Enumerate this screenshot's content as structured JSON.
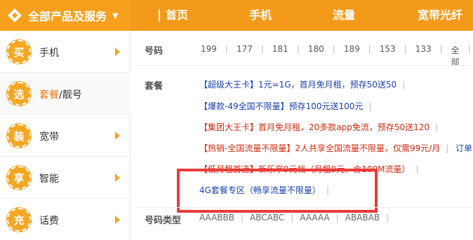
{
  "header": {
    "category_title": "全部产品及服务",
    "nav": [
      "首页",
      "手机",
      "流量",
      "宽带光纤"
    ]
  },
  "sidebar": {
    "items": [
      {
        "badge": "买",
        "label": "手机",
        "label_highlight": "",
        "label_rest": ""
      },
      {
        "badge": "选",
        "label": "",
        "label_highlight": "套餐",
        "label_rest": "/靓号"
      },
      {
        "badge": "装",
        "label": "宽带",
        "label_highlight": "",
        "label_rest": ""
      },
      {
        "badge": "享",
        "label": "智能",
        "label_highlight": "",
        "label_rest": ""
      },
      {
        "badge": "充",
        "label": "话费",
        "label_highlight": "",
        "label_rest": ""
      }
    ]
  },
  "content": {
    "number_label": "号码",
    "number_prefixes": [
      "199",
      "177",
      "181",
      "180",
      "189",
      "153",
      "133",
      "全部"
    ],
    "package_label": "套餐",
    "packages": [
      "【超级大王卡】1元=1G，首月免月租，预存50送50",
      "【爆款-49全国不限量】预存100元送100元",
      "【集团大王卡】首月免月租，20多款app免流，预存50送120",
      "【热销-全国流量不限量】2人共享全国流量不限量，仅需99元/月",
      "订单",
      "【低月租首选】新乐享9元档（月租9元，含100M流量）",
      "4G套餐专区（畅享流量不限量）"
    ],
    "number_type_label": "号码类型",
    "number_types": [
      "AAABBB",
      "ABCABC",
      "AAAAA",
      "ABABAB"
    ]
  },
  "colors": {
    "orange": "#f49a1b",
    "link_blue": "#1a3fb0",
    "promo_red": "#d02a0e",
    "highlight_box": "#ec3a3a"
  }
}
